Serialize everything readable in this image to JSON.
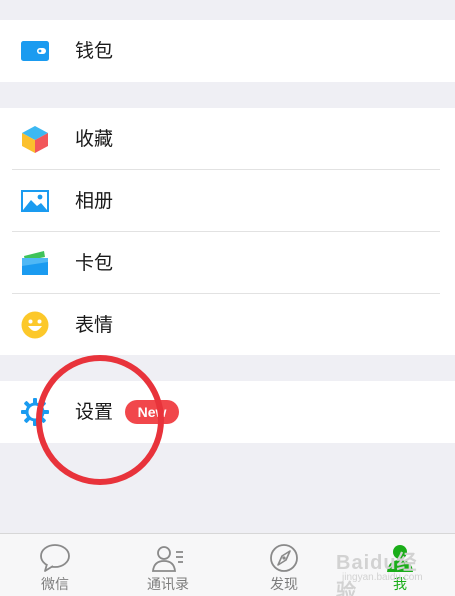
{
  "menu": {
    "wallet_label": "钱包",
    "favorites_label": "收藏",
    "album_label": "相册",
    "cards_label": "卡包",
    "stickers_label": "表情",
    "settings_label": "设置",
    "settings_badge": "New"
  },
  "tabbar": {
    "tabs": [
      {
        "label": "微信",
        "icon": "chat-bubble-icon"
      },
      {
        "label": "通讯录",
        "icon": "contacts-icon"
      },
      {
        "label": "发现",
        "icon": "compass-icon"
      },
      {
        "label": "我",
        "icon": "person-icon",
        "active": true
      }
    ]
  },
  "watermark": {
    "line1": "Baidu经验",
    "line2": "jingyan.baidu.com"
  },
  "colors": {
    "accent": "#1aad19",
    "badge": "#f1474b",
    "annotation_circle": "#e8333b",
    "background": "#efeff4"
  }
}
